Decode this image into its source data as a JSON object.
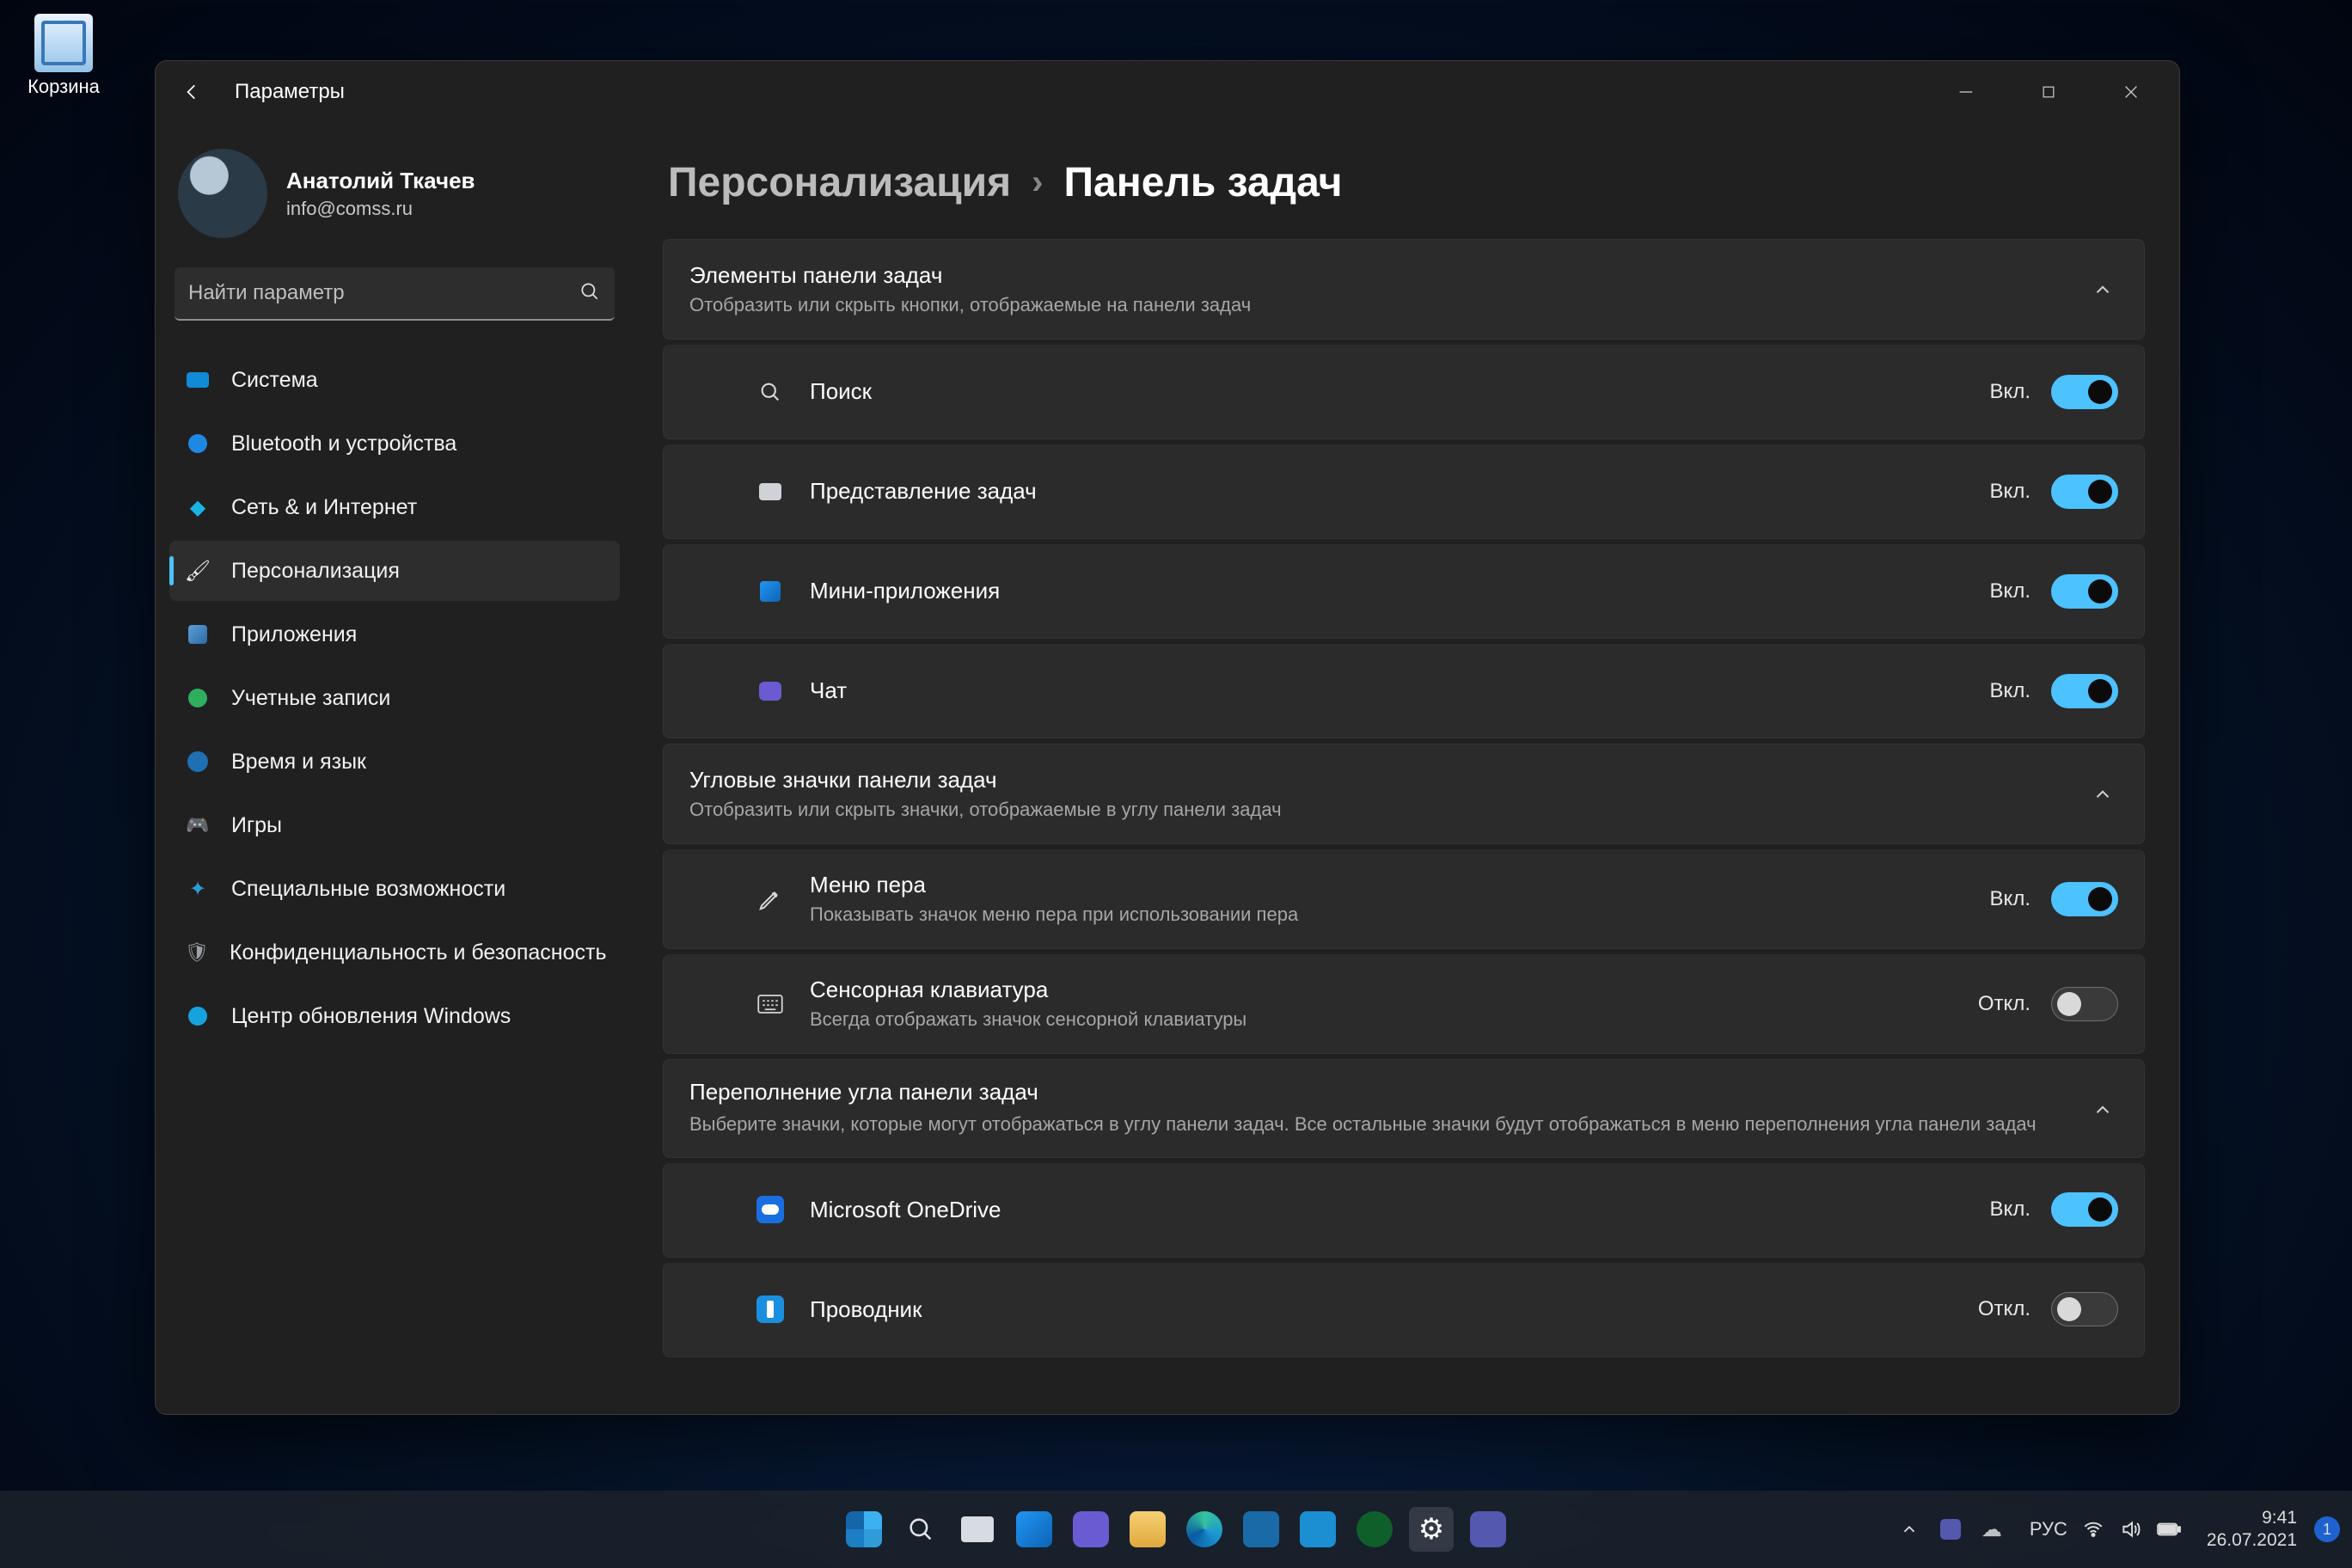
{
  "desktop": {
    "recycle_bin": "Корзина"
  },
  "window": {
    "title": "Параметры",
    "breadcrumb": {
      "section": "Персонализация",
      "page": "Панель задач"
    }
  },
  "profile": {
    "name": "Анатолий Ткачев",
    "email": "info@comss.ru"
  },
  "search": {
    "placeholder": "Найти параметр"
  },
  "sidebar": {
    "items": [
      {
        "label": "Система"
      },
      {
        "label": "Bluetooth и устройства"
      },
      {
        "label": "Сеть & и Интернет"
      },
      {
        "label": "Персонализация"
      },
      {
        "label": "Приложения"
      },
      {
        "label": "Учетные записи"
      },
      {
        "label": "Время и язык"
      },
      {
        "label": "Игры"
      },
      {
        "label": "Специальные возможности"
      },
      {
        "label": "Конфиденциальность и безопасность"
      },
      {
        "label": "Центр обновления Windows"
      }
    ],
    "active_index": 3
  },
  "sections": {
    "taskbar_items": {
      "title": "Элементы панели задач",
      "subtitle": "Отобразить или скрыть кнопки, отображаемые на панели задач",
      "rows": [
        {
          "label": "Поиск",
          "state": "Вкл.",
          "on": true
        },
        {
          "label": "Представление задач",
          "state": "Вкл.",
          "on": true
        },
        {
          "label": "Мини-приложения",
          "state": "Вкл.",
          "on": true
        },
        {
          "label": "Чат",
          "state": "Вкл.",
          "on": true
        }
      ]
    },
    "corner_icons": {
      "title": "Угловые значки панели задач",
      "subtitle": "Отобразить или скрыть значки, отображаемые в углу панели задач",
      "rows": [
        {
          "label": "Меню пера",
          "sub": "Показывать значок меню пера при использовании пера",
          "state": "Вкл.",
          "on": true
        },
        {
          "label": "Сенсорная клавиатура",
          "sub": "Всегда отображать значок сенсорной клавиатуры",
          "state": "Откл.",
          "on": false
        }
      ]
    },
    "overflow": {
      "title": "Переполнение угла панели задач",
      "subtitle": "Выберите значки, которые могут отображаться в углу панели задач. Все остальные значки будут отображаться в меню переполнения угла панели задач",
      "rows": [
        {
          "label": "Microsoft OneDrive",
          "state": "Вкл.",
          "on": true
        },
        {
          "label": "Проводник",
          "state": "Откл.",
          "on": false
        }
      ]
    }
  },
  "tray": {
    "lang": "РУС",
    "time": "9:41",
    "date": "26.07.2021",
    "notifications": "1"
  }
}
